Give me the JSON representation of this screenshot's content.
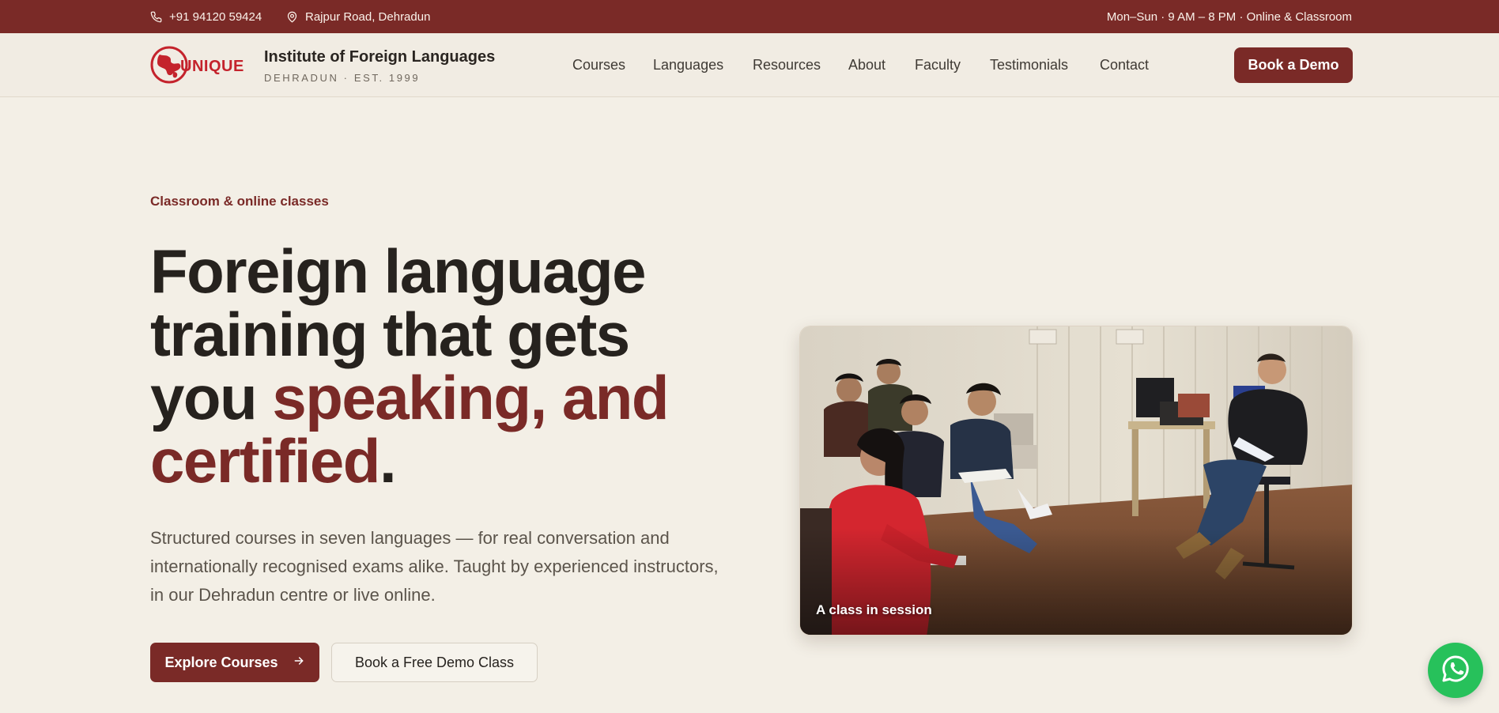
{
  "topbar": {
    "phone": "+91 94120 59424",
    "address": "Rajpur Road, Dehradun",
    "hours": "Mon–Sun · 9 AM – 8 PM · Online & Classroom",
    "icons": [
      "phone-icon",
      "map-pin-icon"
    ]
  },
  "brand": {
    "logo_text": "UNIQUE",
    "name": "Institute of Foreign Languages",
    "tagline": "DEHRADUN · EST. 1999"
  },
  "nav": {
    "links": [
      "Courses",
      "Languages",
      "Resources",
      "About",
      "Faculty",
      "Testimonials",
      "Contact"
    ],
    "cta": "Book a Demo"
  },
  "hero": {
    "eyebrow": "Classroom & online classes",
    "headline_plain": "Foreign language training that gets you ",
    "headline_accent": "speaking, and certified",
    "headline_end": ".",
    "description": "Structured courses in seven languages — for real conversation and internationally recognised exams alike. Taught by experienced instructors, in our Dehradun centre or live online.",
    "primary_button": "Explore Courses",
    "secondary_button": "Book a Free Demo Class",
    "photo_caption": "A class in session"
  },
  "floating": {
    "whatsapp_icon": "whatsapp-icon"
  },
  "colors": {
    "brand": "#7a2a27",
    "background": "#f3efe6",
    "text": "#26221e",
    "whatsapp": "#27c15b"
  }
}
